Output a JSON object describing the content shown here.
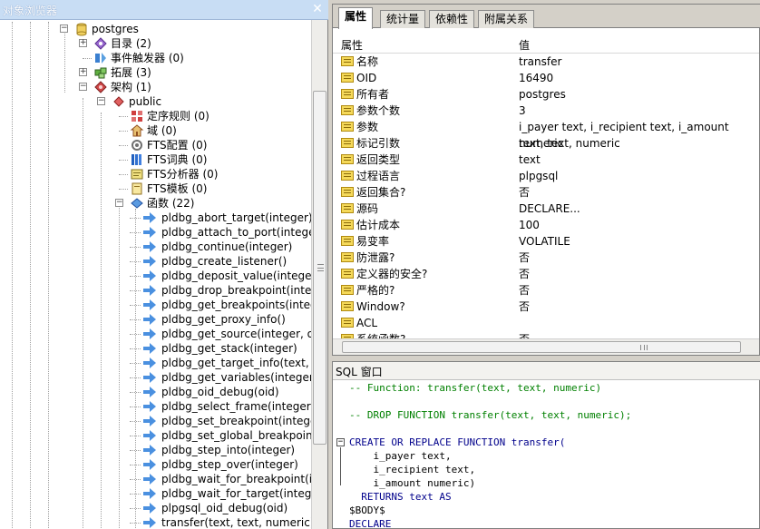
{
  "browser": {
    "title": "对象浏览器",
    "close_glyph": "✕",
    "tree": [
      {
        "label": "postgres",
        "icon": "database-icon",
        "expander": "−"
      },
      {
        "label": "目录 (2)",
        "icon": "catalog-icon",
        "expander": "+"
      },
      {
        "label": "事件触发器 (0)",
        "icon": "event-trigger-icon",
        "expander": ""
      },
      {
        "label": "拓展 (3)",
        "icon": "extension-icon",
        "expander": "+"
      },
      {
        "label": "架构 (1)",
        "icon": "schema-icon",
        "expander": "−"
      },
      {
        "label": "public",
        "icon": "public-schema-icon",
        "expander": "−"
      },
      {
        "label": "定序规则 (0)",
        "icon": "collation-icon",
        "expander": ""
      },
      {
        "label": "域 (0)",
        "icon": "domain-icon",
        "expander": ""
      },
      {
        "label": "FTS配置 (0)",
        "icon": "fts-config-icon",
        "expander": ""
      },
      {
        "label": "FTS词典 (0)",
        "icon": "fts-dictionary-icon",
        "expander": ""
      },
      {
        "label": "FTS分析器 (0)",
        "icon": "fts-parser-icon",
        "expander": ""
      },
      {
        "label": "FTS模板 (0)",
        "icon": "fts-template-icon",
        "expander": ""
      },
      {
        "label": "函数 (22)",
        "icon": "functions-icon",
        "expander": "−"
      }
    ],
    "functions": [
      "pldbg_abort_target(integer)",
      "pldbg_attach_to_port(integer",
      "pldbg_continue(integer)",
      "pldbg_create_listener()",
      "pldbg_deposit_value(integer, '",
      "pldbg_drop_breakpoint(intege",
      "pldbg_get_breakpoints(intege",
      "pldbg_get_proxy_info()",
      "pldbg_get_source(integer, oid",
      "pldbg_get_stack(integer)",
      "pldbg_get_target_info(text, \"",
      "pldbg_get_variables(integer)",
      "pldbg_oid_debug(oid)",
      "pldbg_select_frame(integer, ir",
      "pldbg_set_breakpoint(integer,",
      "pldbg_set_global_breakpoint(i",
      "pldbg_step_into(integer)",
      "pldbg_step_over(integer)",
      "pldbg_wait_for_breakpoint(int",
      "pldbg_wait_for_target(integer",
      "plpgsql_oid_debug(oid)",
      "transfer(text, text, numeric)"
    ]
  },
  "props": {
    "tabs": [
      "属性",
      "统计量",
      "依赖性",
      "附属关系"
    ],
    "col_name": "属性",
    "col_value": "值",
    "rows": [
      {
        "name": "名称",
        "value": "transfer"
      },
      {
        "name": "OID",
        "value": "16490"
      },
      {
        "name": "所有者",
        "value": "postgres"
      },
      {
        "name": "参数个数",
        "value": "3"
      },
      {
        "name": "参数",
        "value": "i_payer text, i_recipient text, i_amount numeric"
      },
      {
        "name": "标记引数",
        "value": "text, text, numeric"
      },
      {
        "name": "返回类型",
        "value": "text"
      },
      {
        "name": "过程语言",
        "value": "plpgsql"
      },
      {
        "name": "返回集合?",
        "value": "否"
      },
      {
        "name": "源码",
        "value": "DECLARE..."
      },
      {
        "name": "估计成本",
        "value": "100"
      },
      {
        "name": "易变率",
        "value": "VOLATILE"
      },
      {
        "name": "防泄露?",
        "value": "否"
      },
      {
        "name": "定义器的安全?",
        "value": "否"
      },
      {
        "name": "严格的?",
        "value": "否"
      },
      {
        "name": "Window?",
        "value": "否"
      },
      {
        "name": "ACL",
        "value": ""
      },
      {
        "name": "系统函数?",
        "value": "否"
      }
    ]
  },
  "sql": {
    "title": "SQL 窗口",
    "lines": [
      {
        "text": "-- Function: transfer(text, text, numeric)",
        "kind": "comment"
      },
      {
        "text": "",
        "kind": "plain"
      },
      {
        "text": "-- DROP FUNCTION transfer(text, text, numeric);",
        "kind": "comment"
      },
      {
        "text": "",
        "kind": "plain"
      },
      {
        "text": "CREATE OR REPLACE FUNCTION transfer(",
        "kind": "keyword"
      },
      {
        "text": "    i_payer text,",
        "kind": "plain"
      },
      {
        "text": "    i_recipient text,",
        "kind": "plain"
      },
      {
        "text": "    i_amount numeric)",
        "kind": "plain"
      },
      {
        "text": "  RETURNS text AS",
        "kind": "keyword"
      },
      {
        "text": "$BODY$",
        "kind": "plain"
      },
      {
        "text": "DECLARE",
        "kind": "keyword"
      }
    ]
  },
  "colors": {
    "title_bar": "#c8ddf4",
    "comment": "#008000",
    "keyword": "#00008b",
    "prop_icon": "#f5d95a"
  }
}
